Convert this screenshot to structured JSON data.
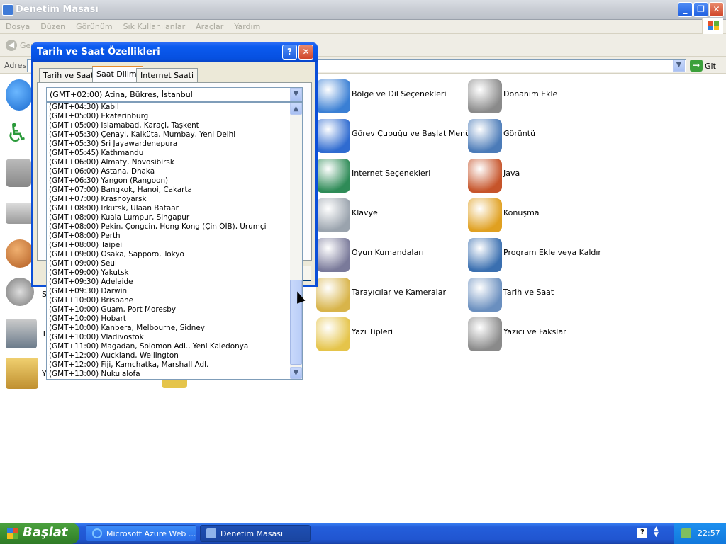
{
  "window": {
    "title": "Denetim Masası"
  },
  "menu": [
    "Dosya",
    "Düzen",
    "Görünüm",
    "Sık Kullanılanlar",
    "Araçlar",
    "Yardım"
  ],
  "toolbar": {
    "back_label": "Geri"
  },
  "address": {
    "label": "Adres",
    "go_label": "Git"
  },
  "items": [
    {
      "label": "Bölge ve Dil Seçenekleri",
      "icon": "globe-clock-icon",
      "color": "#3a7fd4"
    },
    {
      "label": "Donanım Ekle",
      "icon": "hardware-icon",
      "color": "#8a8a8a"
    },
    {
      "label": "Görev Çubuğu ve Başlat Menüsü",
      "icon": "taskbar-icon",
      "color": "#2f6bd0"
    },
    {
      "label": "Görüntü",
      "icon": "display-icon",
      "color": "#4b7bb8"
    },
    {
      "label": "Internet Seçenekleri",
      "icon": "internet-options-icon",
      "color": "#2e8b57"
    },
    {
      "label": "Java",
      "icon": "java-icon",
      "color": "#c6542a"
    },
    {
      "label": "Klavye",
      "icon": "keyboard-icon",
      "color": "#9aa3ad"
    },
    {
      "label": "Konuşma",
      "icon": "speech-icon",
      "color": "#e0a020"
    },
    {
      "label": "Oyun Kumandaları",
      "icon": "gamepad-icon",
      "color": "#7a7a9a"
    },
    {
      "label": "Program Ekle veya Kaldır",
      "icon": "add-remove-programs-icon",
      "color": "#3a6fb0"
    },
    {
      "label": "Tarayıcılar ve Kameralar",
      "icon": "scanner-camera-icon",
      "color": "#d8b44a"
    },
    {
      "label": "Tarih ve Saat",
      "icon": "date-time-icon",
      "color": "#6a8fbf"
    },
    {
      "label": "Yazı Tipleri",
      "icon": "fonts-folder-icon",
      "color": "#e5c44a"
    },
    {
      "label": "Yazıcı ve Fakslar",
      "icon": "printer-fax-icon",
      "color": "#8a8a8a"
    }
  ],
  "left_partial": {
    "sounds_initial": "S",
    "phone_initial": "T",
    "tasks_initial": "Y"
  },
  "dialog": {
    "title": "Tarih ve Saat Özellikleri",
    "tabs": [
      "Tarih ve Saat",
      "Saat Dilimi",
      "Internet Saati"
    ],
    "selected_zone": "(GMT+02:00) Atina, Bükreş, İstanbul",
    "zones": [
      "(GMT+04:30) Kabil",
      "(GMT+05:00) Ekaterinburg",
      "(GMT+05:00) Islamabad, Karaçi, Taşkent",
      "(GMT+05:30) Çenayi, Kalküta, Mumbay, Yeni Delhi",
      "(GMT+05:30) Sri Jayawardenepura",
      "(GMT+05:45) Kathmandu",
      "(GMT+06:00) Almaty, Novosibirsk",
      "(GMT+06:00) Astana, Dhaka",
      "(GMT+06:30) Yangon (Rangoon)",
      "(GMT+07:00) Bangkok, Hanoi, Cakarta",
      "(GMT+07:00) Krasnoyarsk",
      "(GMT+08:00) Irkutsk, Ulaan Bataar",
      "(GMT+08:00) Kuala Lumpur, Singapur",
      "(GMT+08:00) Pekin, Çongcin, Hong Kong (Çin ÖİB), Urumçi",
      "(GMT+08:00) Perth",
      "(GMT+08:00) Taipei",
      "(GMT+09:00) Osaka, Sapporo, Tokyo",
      "(GMT+09:00) Seul",
      "(GMT+09:00) Yakutsk",
      "(GMT+09:30) Adelaide",
      "(GMT+09:30) Darwin",
      "(GMT+10:00) Brisbane",
      "(GMT+10:00) Guam, Port Moresby",
      "(GMT+10:00) Hobart",
      "(GMT+10:00) Kanbera, Melbourne, Sidney",
      "(GMT+10:00) Vladivostok",
      "(GMT+11:00) Magadan, Solomon Adl., Yeni Kaledonya",
      "(GMT+12:00) Auckland, Wellington",
      "(GMT+12:00) Fiji, Kamchatka, Marshall Adl.",
      "(GMT+13:00) Nuku'alofa"
    ],
    "help_glyph": "?",
    "close_glyph": "✕"
  },
  "taskbar": {
    "start_label": "Başlat",
    "buttons": [
      "Microsoft Azure Web ...",
      "Denetim Masası"
    ],
    "clock": "22:57"
  }
}
